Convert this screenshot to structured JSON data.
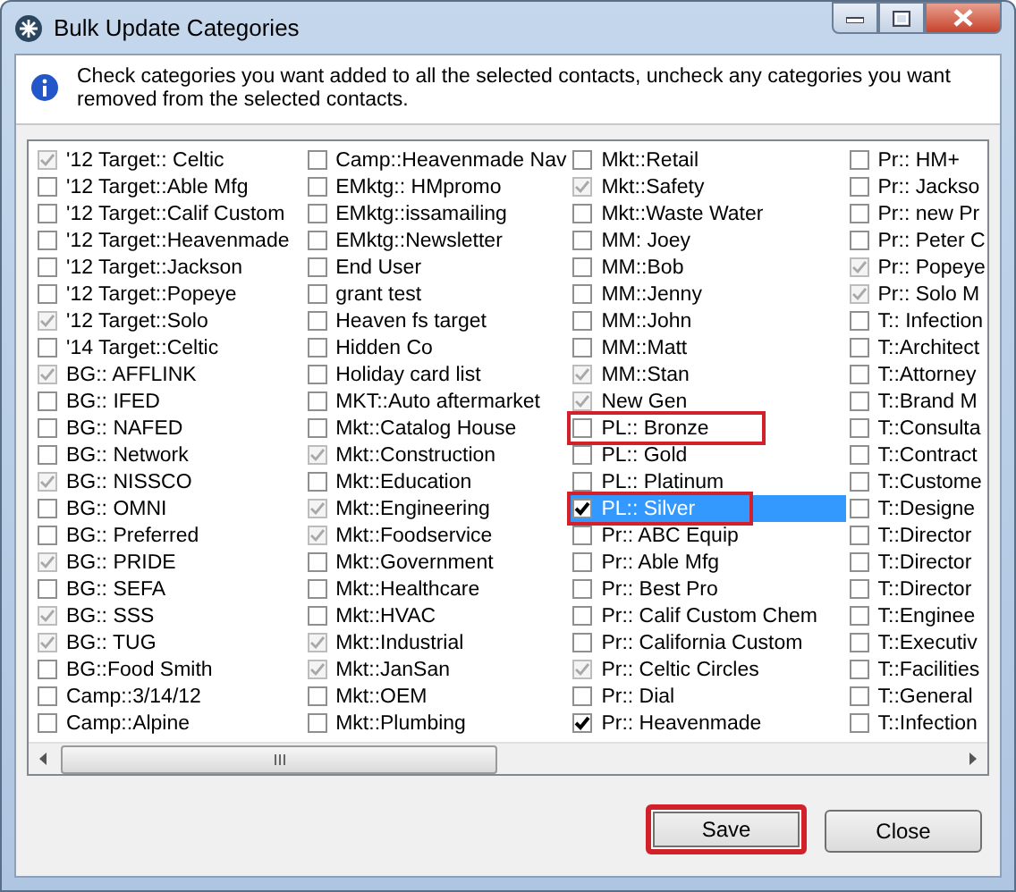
{
  "window": {
    "title": "Bulk Update Categories"
  },
  "info": {
    "message": "Check categories you want added to all the selected contacts, uncheck any categories you want removed from the selected contacts."
  },
  "columns": [
    [
      {
        "label": "'12 Target:: Celtic",
        "checked": true,
        "disabled": true
      },
      {
        "label": "'12 Target::Able Mfg",
        "checked": false,
        "disabled": false
      },
      {
        "label": "'12 Target::Calif Custom",
        "checked": false,
        "disabled": false
      },
      {
        "label": "'12 Target::Heavenmade",
        "checked": false,
        "disabled": false
      },
      {
        "label": "'12 Target::Jackson",
        "checked": false,
        "disabled": false
      },
      {
        "label": "'12 Target::Popeye",
        "checked": false,
        "disabled": false
      },
      {
        "label": "'12 Target::Solo",
        "checked": true,
        "disabled": true
      },
      {
        "label": "'14 Target::Celtic",
        "checked": false,
        "disabled": false
      },
      {
        "label": "BG:: AFFLINK",
        "checked": true,
        "disabled": true
      },
      {
        "label": "BG:: IFED",
        "checked": false,
        "disabled": false
      },
      {
        "label": "BG:: NAFED",
        "checked": false,
        "disabled": false
      },
      {
        "label": "BG:: Network",
        "checked": false,
        "disabled": false
      },
      {
        "label": "BG:: NISSCO",
        "checked": true,
        "disabled": true
      },
      {
        "label": "BG:: OMNI",
        "checked": false,
        "disabled": false
      },
      {
        "label": "BG:: Preferred",
        "checked": false,
        "disabled": false
      },
      {
        "label": "BG:: PRIDE",
        "checked": true,
        "disabled": true
      },
      {
        "label": "BG:: SEFA",
        "checked": false,
        "disabled": false
      },
      {
        "label": "BG:: SSS",
        "checked": true,
        "disabled": true
      },
      {
        "label": "BG:: TUG",
        "checked": true,
        "disabled": true
      },
      {
        "label": "BG::Food Smith",
        "checked": false,
        "disabled": false
      },
      {
        "label": "Camp::3/14/12",
        "checked": false,
        "disabled": false
      },
      {
        "label": "Camp::Alpine",
        "checked": false,
        "disabled": false
      }
    ],
    [
      {
        "label": "Camp::Heavenmade Nav",
        "checked": false,
        "disabled": false
      },
      {
        "label": "EMktg:: HMpromo",
        "checked": false,
        "disabled": false
      },
      {
        "label": "EMktg::issamailing",
        "checked": false,
        "disabled": false
      },
      {
        "label": "EMktg::Newsletter",
        "checked": false,
        "disabled": false
      },
      {
        "label": "End User",
        "checked": false,
        "disabled": false
      },
      {
        "label": "grant test",
        "checked": false,
        "disabled": false
      },
      {
        "label": "Heaven fs target",
        "checked": false,
        "disabled": false
      },
      {
        "label": "Hidden Co",
        "checked": false,
        "disabled": false
      },
      {
        "label": "Holiday card list",
        "checked": false,
        "disabled": false
      },
      {
        "label": "MKT::Auto aftermarket",
        "checked": false,
        "disabled": false
      },
      {
        "label": "Mkt::Catalog House",
        "checked": false,
        "disabled": false
      },
      {
        "label": "Mkt::Construction",
        "checked": true,
        "disabled": true
      },
      {
        "label": "Mkt::Education",
        "checked": false,
        "disabled": false
      },
      {
        "label": "Mkt::Engineering",
        "checked": true,
        "disabled": true
      },
      {
        "label": "Mkt::Foodservice",
        "checked": true,
        "disabled": true
      },
      {
        "label": "Mkt::Government",
        "checked": false,
        "disabled": false
      },
      {
        "label": "Mkt::Healthcare",
        "checked": false,
        "disabled": false
      },
      {
        "label": "Mkt::HVAC",
        "checked": false,
        "disabled": false
      },
      {
        "label": "Mkt::Industrial",
        "checked": true,
        "disabled": true
      },
      {
        "label": "Mkt::JanSan",
        "checked": true,
        "disabled": true
      },
      {
        "label": "Mkt::OEM",
        "checked": false,
        "disabled": false
      },
      {
        "label": "Mkt::Plumbing",
        "checked": false,
        "disabled": false
      }
    ],
    [
      {
        "label": "Mkt::Retail",
        "checked": false,
        "disabled": false
      },
      {
        "label": "Mkt::Safety",
        "checked": true,
        "disabled": true
      },
      {
        "label": "Mkt::Waste Water",
        "checked": false,
        "disabled": false
      },
      {
        "label": "MM: Joey",
        "checked": false,
        "disabled": false
      },
      {
        "label": "MM::Bob",
        "checked": false,
        "disabled": false
      },
      {
        "label": "MM::Jenny",
        "checked": false,
        "disabled": false
      },
      {
        "label": "MM::John",
        "checked": false,
        "disabled": false
      },
      {
        "label": "MM::Matt",
        "checked": false,
        "disabled": false
      },
      {
        "label": "MM::Stan",
        "checked": true,
        "disabled": true
      },
      {
        "label": "New Gen",
        "checked": true,
        "disabled": true
      },
      {
        "label": "PL:: Bronze",
        "checked": false,
        "disabled": false,
        "highlighted": true
      },
      {
        "label": "PL:: Gold",
        "checked": false,
        "disabled": false
      },
      {
        "label": "PL:: Platinum",
        "checked": false,
        "disabled": false
      },
      {
        "label": "PL:: Silver",
        "checked": true,
        "disabled": false,
        "highlighted": true,
        "selected": true
      },
      {
        "label": "Pr:: ABC Equip",
        "checked": false,
        "disabled": false
      },
      {
        "label": "Pr:: Able Mfg",
        "checked": false,
        "disabled": false
      },
      {
        "label": "Pr:: Best Pro",
        "checked": false,
        "disabled": false
      },
      {
        "label": "Pr:: Calif Custom Chem",
        "checked": false,
        "disabled": false
      },
      {
        "label": "Pr:: California Custom",
        "checked": false,
        "disabled": false
      },
      {
        "label": "Pr:: Celtic Circles",
        "checked": true,
        "disabled": true
      },
      {
        "label": "Pr:: Dial",
        "checked": false,
        "disabled": false
      },
      {
        "label": "Pr:: Heavenmade",
        "checked": true,
        "disabled": false
      }
    ],
    [
      {
        "label": "Pr:: HM+",
        "checked": false,
        "disabled": false
      },
      {
        "label": "Pr:: Jackso",
        "checked": false,
        "disabled": false
      },
      {
        "label": "Pr:: new Pr",
        "checked": false,
        "disabled": false
      },
      {
        "label": "Pr:: Peter C",
        "checked": false,
        "disabled": false
      },
      {
        "label": "Pr:: Popeye",
        "checked": true,
        "disabled": true
      },
      {
        "label": "Pr:: Solo M",
        "checked": true,
        "disabled": true
      },
      {
        "label": "T:: Infection",
        "checked": false,
        "disabled": false
      },
      {
        "label": "T::Architect",
        "checked": false,
        "disabled": false
      },
      {
        "label": "T::Attorney",
        "checked": false,
        "disabled": false
      },
      {
        "label": "T::Brand M",
        "checked": false,
        "disabled": false
      },
      {
        "label": "T::Consulta",
        "checked": false,
        "disabled": false
      },
      {
        "label": "T::Contract",
        "checked": false,
        "disabled": false
      },
      {
        "label": "T::Custome",
        "checked": false,
        "disabled": false
      },
      {
        "label": "T::Designe",
        "checked": false,
        "disabled": false
      },
      {
        "label": "T::Director",
        "checked": false,
        "disabled": false
      },
      {
        "label": "T::Director",
        "checked": false,
        "disabled": false
      },
      {
        "label": "T::Director",
        "checked": false,
        "disabled": false
      },
      {
        "label": "T::Enginee",
        "checked": false,
        "disabled": false
      },
      {
        "label": "T::Executiv",
        "checked": false,
        "disabled": false
      },
      {
        "label": "T::Facilities",
        "checked": false,
        "disabled": false
      },
      {
        "label": "T::General",
        "checked": false,
        "disabled": false
      },
      {
        "label": "T::Infection",
        "checked": false,
        "disabled": false
      }
    ]
  ],
  "buttons": [
    {
      "label": "Save",
      "highlighted": true
    },
    {
      "label": "Close",
      "highlighted": false
    }
  ]
}
